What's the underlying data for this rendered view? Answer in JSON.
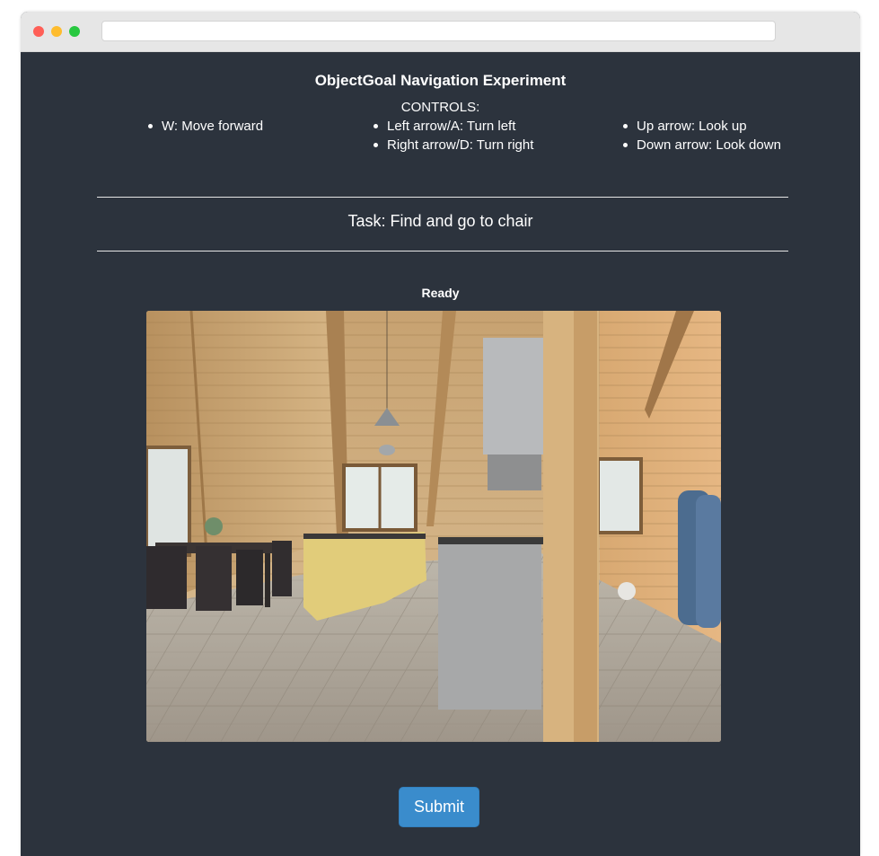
{
  "window": {
    "url": ""
  },
  "page": {
    "title": "ObjectGoal Navigation Experiment",
    "controls_heading": "CONTROLS:",
    "controls": {
      "column1": [
        "W: Move forward"
      ],
      "column2": [
        "Left arrow/A: Turn left",
        "Right arrow/D: Turn right"
      ],
      "column3": [
        "Up arrow: Look up",
        "Down arrow: Look down"
      ]
    },
    "task": "Task: Find and go to chair",
    "status": "Ready",
    "submit_label": "Submit"
  },
  "colors": {
    "background": "#2c333d",
    "button": "#3a8ccc",
    "text": "#ffffff"
  }
}
